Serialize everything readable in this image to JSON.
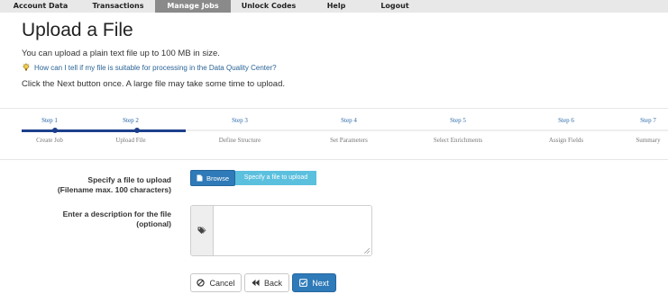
{
  "nav": {
    "items": [
      {
        "label": "Account Data",
        "active": false
      },
      {
        "label": "Transactions",
        "active": false
      },
      {
        "label": "Manage Jobs",
        "active": true
      },
      {
        "label": "Unlock Codes",
        "active": false
      },
      {
        "label": "Help",
        "active": false
      },
      {
        "label": "Logout",
        "active": false
      }
    ]
  },
  "page": {
    "title": "Upload a File",
    "intro1": "You can upload a plain text file up to 100 MB in size.",
    "help_link": "How can I tell if my file is suitable for processing in the Data Quality Center?",
    "intro2": "Click the Next button once. A large file may take some time to upload."
  },
  "stepper": {
    "current_step": 2,
    "steps": [
      {
        "top": "Step 1",
        "bottom": "Create Job"
      },
      {
        "top": "Step 2",
        "bottom": "Upload File"
      },
      {
        "top": "Step 3",
        "bottom": "Define Structure"
      },
      {
        "top": "Step 4",
        "bottom": "Set Parameters"
      },
      {
        "top": "Step 5",
        "bottom": "Select Enrichments"
      },
      {
        "top": "Step 6",
        "bottom": "Assign Fields"
      },
      {
        "top": "Step 7",
        "bottom": "Summary"
      }
    ]
  },
  "form": {
    "file_label_1": "Specify a file to upload",
    "file_label_2": "(Filename max. 100 characters)",
    "browse_label": "Browse",
    "file_placeholder": "Specify a file to upload",
    "desc_label_1": "Enter a description for the file",
    "desc_label_2": "(optional)",
    "desc_value": ""
  },
  "buttons": {
    "cancel": "Cancel",
    "back": "Back",
    "next": "Next"
  },
  "colors": {
    "primary": "#2f7ab8",
    "info": "#5bc0de",
    "progress": "#1c3f8c",
    "nav_active": "#8a8a8a",
    "link": "#2a6496"
  }
}
